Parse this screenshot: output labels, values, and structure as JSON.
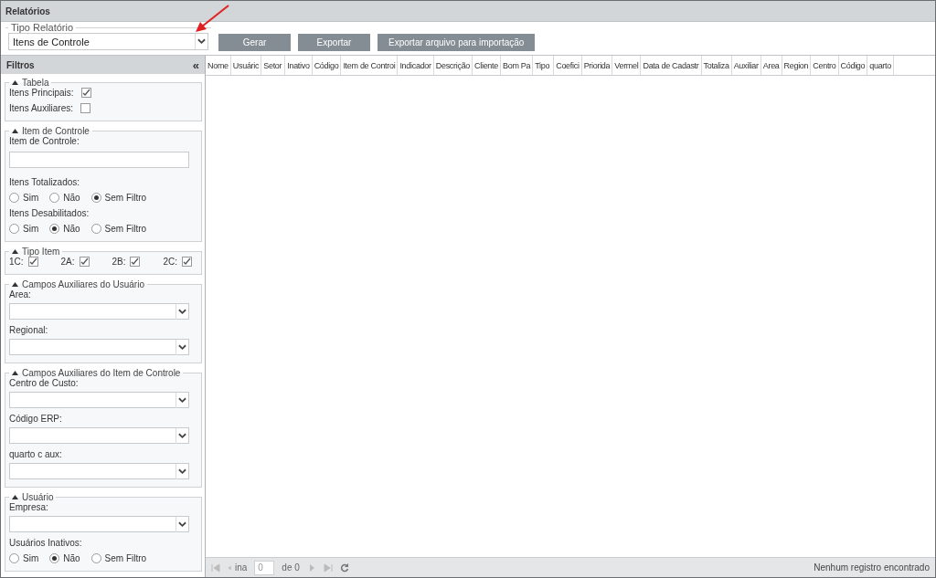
{
  "title": "Relatórios",
  "report_type": {
    "legend": "Tipo Relatório",
    "value": "Itens de Controle"
  },
  "actions": [
    "Gerar",
    "Exportar",
    "Exportar arquivo para importação"
  ],
  "filters": {
    "title": "Filtros",
    "collapse": "«",
    "sections": [
      {
        "title": "Tabela",
        "expanded": true,
        "items": [
          {
            "kind": "checkbox",
            "label": "Itens Principais:",
            "checked": true
          },
          {
            "kind": "checkbox",
            "label": "Itens Auxiliares:",
            "checked": false
          }
        ]
      },
      {
        "title": "Item de Controle",
        "expanded": true,
        "items": [
          {
            "kind": "text",
            "label": "Item de Controle:"
          },
          {
            "kind": "radio",
            "label": "Itens Totalizados:",
            "options": [
              {
                "label": "Sim",
                "selected": false
              },
              {
                "label": "Não",
                "selected": false
              },
              {
                "label": "Sem Filtro",
                "selected": true
              }
            ]
          },
          {
            "kind": "radio",
            "label": "Itens Desabilitados:",
            "options": [
              {
                "label": "Sim",
                "selected": false
              },
              {
                "label": "Não",
                "selected": true
              },
              {
                "label": "Sem Filtro",
                "selected": false
              }
            ]
          }
        ]
      },
      {
        "title": "Tipo Item",
        "expanded": true,
        "items": [
          {
            "kind": "checkrow",
            "options": [
              {
                "label": "1C:",
                "checked": true
              },
              {
                "label": "2A:",
                "checked": true
              },
              {
                "label": "2B:",
                "checked": true
              },
              {
                "label": "2C:",
                "checked": true
              }
            ]
          }
        ]
      },
      {
        "title": "Campos Auxiliares do Usuário",
        "expanded": true,
        "items": [
          {
            "kind": "select",
            "label": "Area:"
          },
          {
            "kind": "select",
            "label": "Regional:"
          }
        ]
      },
      {
        "title": "Campos Auxiliares do Item de Controle",
        "expanded": true,
        "items": [
          {
            "kind": "select",
            "label": "Centro de Custo:"
          },
          {
            "kind": "select",
            "label": "Código ERP:"
          },
          {
            "kind": "select",
            "label": "quarto c aux:"
          }
        ]
      },
      {
        "title": "Usuário",
        "expanded": true,
        "items": [
          {
            "kind": "select",
            "label": "Empresa:"
          },
          {
            "kind": "radio",
            "label": "Usuários Inativos:",
            "options": [
              {
                "label": "Sim",
                "selected": false
              },
              {
                "label": "Não",
                "selected": true
              },
              {
                "label": "Sem Filtro",
                "selected": false
              }
            ]
          }
        ]
      }
    ]
  },
  "table": {
    "columns": [
      "Nome",
      "Usuáric",
      "Setor",
      "Inativo",
      "Código",
      "Item de Controi",
      "Indicador",
      "Descrição",
      "Cliente",
      "Bom Pa",
      "Tipo",
      "Coefici",
      "Priorida",
      "Vermel",
      "Data de Cadastr",
      "Totaliza",
      "Auxiliar",
      "Area",
      "Region",
      "Centro",
      "Código",
      "quarto"
    ]
  },
  "pager": {
    "page_label": "ina",
    "page": "0",
    "of": "de 0",
    "status": "Nenhum registro encontrado"
  }
}
